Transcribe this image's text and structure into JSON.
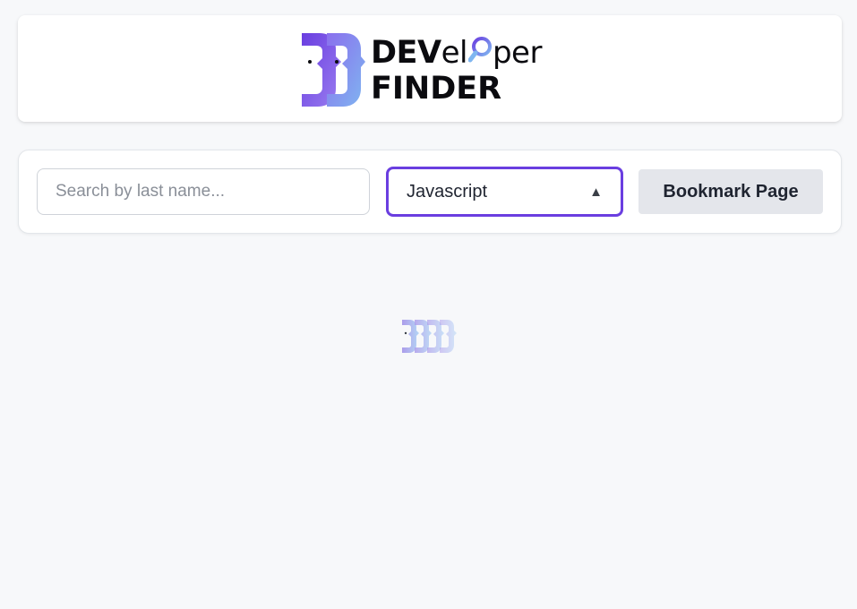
{
  "header": {
    "logo": {
      "part1": "DEV",
      "part2a": "el",
      "part2b": "per",
      "line2": "FINDER"
    }
  },
  "toolbar": {
    "search": {
      "placeholder": "Search by last name...",
      "value": ""
    },
    "language_select": {
      "selected": "Javascript"
    },
    "bookmark_label": "Bookmark Page"
  },
  "colors": {
    "accent": "#6a3ee0",
    "logo_gradient_start": "#6a3ee0",
    "logo_gradient_end": "#7fb6f0",
    "background": "#f7f8fa"
  },
  "icons": {
    "logo_mark": "developer-faces-icon",
    "magnifier": "magnifier-icon",
    "select_caret": "caret-up-icon",
    "loader": "loading-faces-icon"
  }
}
